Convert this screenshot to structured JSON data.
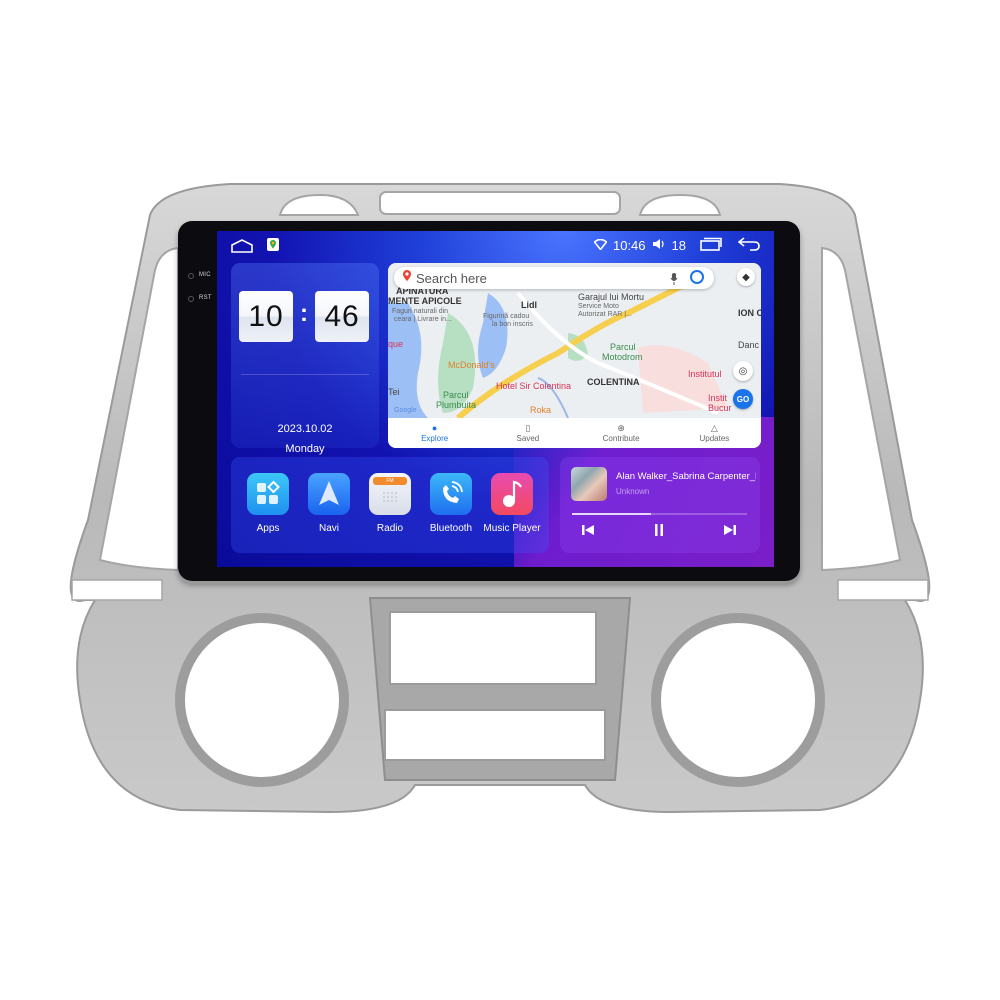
{
  "device": {
    "hw_buttons": [
      {
        "label": "MIC"
      },
      {
        "label": "RST"
      }
    ]
  },
  "statusbar": {
    "time": "10:46",
    "volume": "18",
    "icons": [
      "home-icon",
      "google-maps-icon",
      "wifi-icon",
      "volume-icon",
      "recent-apps-icon",
      "back-icon"
    ]
  },
  "clock_widget": {
    "hours": "10",
    "minutes": "46",
    "separator": ":",
    "date": "2023.10.02",
    "weekday": "Monday"
  },
  "map_widget": {
    "search_placeholder": "Search here",
    "labels": [
      {
        "text": "APINATURA"
      },
      {
        "text": "MENTE APICOLE"
      },
      {
        "text": "Faguri naturali din"
      },
      {
        "text": "ceara | Livrare in..."
      },
      {
        "text": "Lidl"
      },
      {
        "text": "Figurină cadou"
      },
      {
        "text": "la bon inscris"
      },
      {
        "text": "Garajul lui Mortu"
      },
      {
        "text": "Service Moto"
      },
      {
        "text": "Autorizat RAR |..."
      },
      {
        "text": "ION C"
      },
      {
        "text": "Parcul"
      },
      {
        "text": "Motodrom"
      },
      {
        "text": "Danc"
      },
      {
        "text": "que"
      },
      {
        "text": "McDonald's"
      },
      {
        "text": "COLENTINA"
      },
      {
        "text": "Institutul"
      },
      {
        "text": "Tei"
      },
      {
        "text": "Hotel Sir Colentina"
      },
      {
        "text": "Parcul"
      },
      {
        "text": "Plumbuita"
      },
      {
        "text": "Roka"
      },
      {
        "text": "Instit"
      },
      {
        "text": "Bucur"
      },
      {
        "text": "Google"
      }
    ],
    "go_label": "GO",
    "nav": [
      {
        "label": "Explore",
        "icon": "location-pin-icon",
        "active": true
      },
      {
        "label": "Saved",
        "icon": "bookmark-icon",
        "active": false
      },
      {
        "label": "Contribute",
        "icon": "add-circle-icon",
        "active": false
      },
      {
        "label": "Updates",
        "icon": "bell-icon",
        "active": false
      }
    ]
  },
  "apps": [
    {
      "label": "Apps",
      "icon": "apps-grid-icon",
      "color": "#2fb3f0"
    },
    {
      "label": "Navi",
      "icon": "navigation-arrow-icon",
      "color": "#2f8dff"
    },
    {
      "label": "Radio",
      "icon": "fm-radio-icon",
      "color": "#e9edf4"
    },
    {
      "label": "Bluetooth",
      "icon": "phone-call-icon",
      "color": "#2a8df5"
    },
    {
      "label": "Music Player",
      "icon": "music-note-icon",
      "color": "#f0467a"
    }
  ],
  "radio_badge": "FM",
  "music": {
    "title": "Alan Walker_Sabrina Carpenter_F...",
    "artist": "Unknown",
    "progress_percent": 45,
    "controls": [
      "previous-icon",
      "pause-icon",
      "next-icon"
    ]
  }
}
